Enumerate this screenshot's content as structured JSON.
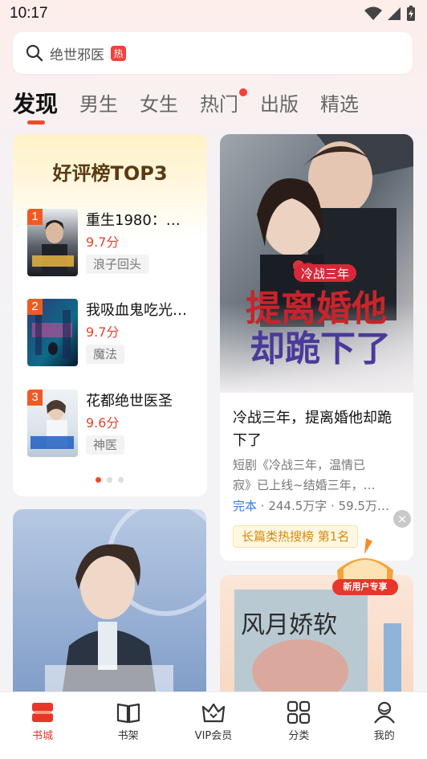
{
  "status_bar": {
    "time": "10:17"
  },
  "search": {
    "text": "绝世邪医",
    "badge": "热"
  },
  "tabs": [
    {
      "label": "发现",
      "active": true
    },
    {
      "label": "男生"
    },
    {
      "label": "女生"
    },
    {
      "label": "热门",
      "dot": true
    },
    {
      "label": "出版"
    },
    {
      "label": "精选"
    }
  ],
  "rank_card": {
    "title": "好评榜TOP3",
    "items": [
      {
        "rank": "1",
        "name": "重生1980：…",
        "score": "9.7分",
        "tag": "浪子回头"
      },
      {
        "rank": "2",
        "name": "我吸血鬼吃光…",
        "score": "9.7分",
        "tag": "魔法"
      },
      {
        "rank": "3",
        "name": "花都绝世医圣",
        "score": "9.6分",
        "tag": "神医"
      }
    ]
  },
  "feature_book": {
    "cover_small_title": "冷战三年",
    "cover_big_title_1": "提离婚他",
    "cover_big_title_2": "却跪下了",
    "title": "冷战三年，提离婚他却跪下了",
    "desc_line1": "短剧《冷战三年，温情已",
    "desc_line2": "寂》已上线~结婚三年，…",
    "status": "完本",
    "meta": " · 244.5万字 · 59.5万…",
    "rank_label": "长篇类热搜榜 第1名"
  },
  "close_label": "×",
  "new_user_label": "新用户专享",
  "right_cover_title": "风月娇软",
  "bottom_nav": [
    {
      "label": "书城",
      "icon": "bookstore-icon",
      "active": true
    },
    {
      "label": "书架",
      "icon": "bookshelf-icon"
    },
    {
      "label": "VIP会员",
      "icon": "vip-crown-icon"
    },
    {
      "label": "分类",
      "icon": "category-grid-icon"
    },
    {
      "label": "我的",
      "icon": "profile-icon"
    }
  ],
  "colors": {
    "accent": "#e8362a",
    "rank_title": "#5a3a12",
    "score": "#e2452c",
    "finished": "#2f7fe0"
  }
}
